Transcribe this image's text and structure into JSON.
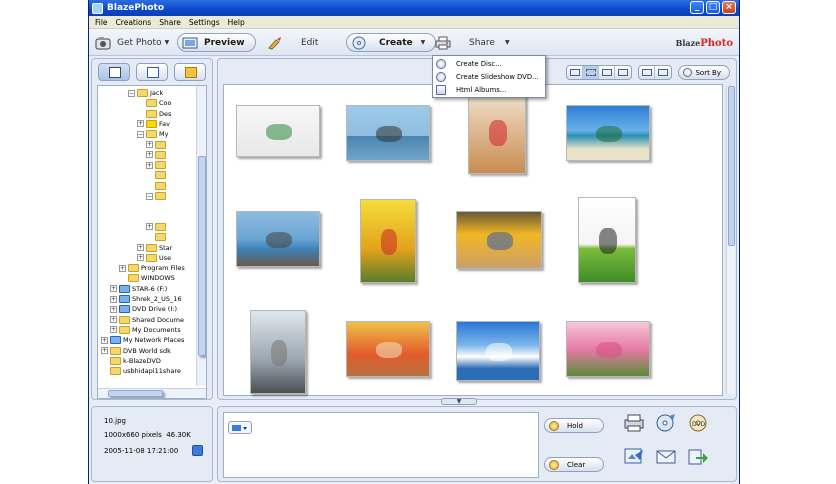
{
  "window": {
    "title": "BlazePhoto",
    "min": "_",
    "max": "□",
    "close": "×"
  },
  "menu": [
    "File",
    "Creations",
    "Share",
    "Settings",
    "Help"
  ],
  "toolbar": {
    "get_photo": "Get Photo",
    "preview": "Preview",
    "edit": "Edit",
    "create": "Create",
    "share": "Share",
    "brand_blaze": "Blaze",
    "brand_photo": "Photo"
  },
  "create_menu": [
    "Create Disc...",
    "Create Slideshow DVD...",
    "Html Albums..."
  ],
  "tree": {
    "rows": [
      {
        "label": "Jack",
        "indent": 4,
        "exp": "⊟",
        "icon": "folder"
      },
      {
        "label": "Coo",
        "indent": 5,
        "exp": "",
        "icon": "folder"
      },
      {
        "label": "Des",
        "indent": 5,
        "exp": "",
        "icon": "folder"
      },
      {
        "label": "Fav",
        "indent": 5,
        "exp": "⊞",
        "icon": "star"
      },
      {
        "label": "My",
        "indent": 5,
        "exp": "⊟",
        "icon": "folder"
      },
      {
        "label": "",
        "indent": 6,
        "exp": "⊞",
        "icon": "folder"
      },
      {
        "label": "",
        "indent": 6,
        "exp": "⊞",
        "icon": "folder"
      },
      {
        "label": "",
        "indent": 6,
        "exp": "⊞",
        "icon": "folder"
      },
      {
        "label": "",
        "indent": 6,
        "exp": "",
        "icon": "folder"
      },
      {
        "label": "",
        "indent": 6,
        "exp": "",
        "icon": "folder"
      },
      {
        "label": "",
        "indent": 6,
        "exp": "⊟",
        "icon": "folder"
      },
      {
        "label": "",
        "indent": 7,
        "exp": "",
        "icon": ""
      },
      {
        "label": "",
        "indent": 7,
        "exp": "",
        "icon": ""
      },
      {
        "label": "",
        "indent": 6,
        "exp": "⊞",
        "icon": "folder"
      },
      {
        "label": "",
        "indent": 6,
        "exp": "",
        "icon": "folder"
      },
      {
        "label": "Star",
        "indent": 5,
        "exp": "⊞",
        "icon": "folder"
      },
      {
        "label": "Use",
        "indent": 5,
        "exp": "⊞",
        "icon": "folder"
      },
      {
        "label": "Program Files",
        "indent": 3,
        "exp": "⊞",
        "icon": "folder"
      },
      {
        "label": "WINDOWS",
        "indent": 3,
        "exp": "",
        "icon": "folder"
      },
      {
        "label": "STAR-6 (F:)",
        "indent": 2,
        "exp": "⊞",
        "icon": "special"
      },
      {
        "label": "Shrek_2_US_16",
        "indent": 2,
        "exp": "⊞",
        "icon": "special"
      },
      {
        "label": "DVD Drive (I:)",
        "indent": 2,
        "exp": "⊞",
        "icon": "special"
      },
      {
        "label": "Shared Docume",
        "indent": 2,
        "exp": "⊞",
        "icon": "folder"
      },
      {
        "label": "My Documents",
        "indent": 2,
        "exp": "⊞",
        "icon": "folder"
      },
      {
        "label": "My Network Places",
        "indent": 1,
        "exp": "⊞",
        "icon": "special"
      },
      {
        "label": "DVB World sdk",
        "indent": 1,
        "exp": "⊞",
        "icon": "folder"
      },
      {
        "label": "k-BlazeDVD",
        "indent": 1,
        "exp": "",
        "icon": "folder"
      },
      {
        "label": "usbhidapi11share",
        "indent": 1,
        "exp": "",
        "icon": "folder"
      }
    ]
  },
  "sort_label": "Sort By",
  "photos": [
    {
      "name": "dice",
      "bg": "linear-gradient(#f7f7f7,#e8e8e8)",
      "accent": "#2a8a3c"
    },
    {
      "name": "pier",
      "bg": "linear-gradient(#9ecbe9 0%,#8fbddd 55%,#4a86b0 56%,#6fa4c9 100%)",
      "accent": "#333"
    },
    {
      "name": "santa-dog",
      "bg": "linear-gradient(#f1e3cf,#c98c52)",
      "accent": "#d2202a"
    },
    {
      "name": "beach",
      "bg": "linear-gradient(#2d7fd4 0%,#68b0ea 45%,#2b8fb2 55%,#e9e3c9 80%)",
      "accent": "#1f6b3a"
    },
    {
      "name": "boats",
      "bg": "linear-gradient(#8cbce0 0%,#6aa5d2 50%,#3d7fb3 70%,#6b5a4e 100%)",
      "accent": "#444"
    },
    {
      "name": "balloons-kid",
      "bg": "linear-gradient(#f6dd3c,#e3a21b 60%,#5b7d2e)",
      "accent": "#c62828"
    },
    {
      "name": "sunflower-hat",
      "bg": "linear-gradient(#6a5a3a,#f2b622 40%,#caa06a)",
      "accent": "#2d5ab0"
    },
    {
      "name": "tree-field",
      "bg": "linear-gradient(#ffffff 0%,#f4f4f4 55%,#7bbd3c 60%,#3f8c28 100%)",
      "accent": "#222"
    },
    {
      "name": "skyscrapers",
      "bg": "linear-gradient(#dfe7ee,#9aa5ad 60%,#4a4f55)",
      "accent": "#777"
    },
    {
      "name": "teddy-bears",
      "bg": "linear-gradient(#f0c04a,#e25b2b 60%,#b7723f)",
      "accent": "#f6e3c0"
    },
    {
      "name": "clouds-sea",
      "bg": "linear-gradient(#2a76d6,#7cb6ea 40%,#ffffff 60%,#2d6db5 80%)",
      "accent": "#fff"
    },
    {
      "name": "pink-flowers",
      "bg": "linear-gradient(#f6c7d9,#e77aa6 50%,#5a8b3a)",
      "accent": "#d94d86"
    }
  ],
  "info": {
    "filename": "10.jpg",
    "dimensions": "1000x660 pixels",
    "size": "46.30K",
    "datetime": "2005-11-08 17:21:00"
  },
  "tray": {
    "hold": "Hold",
    "clear": "Clear"
  }
}
